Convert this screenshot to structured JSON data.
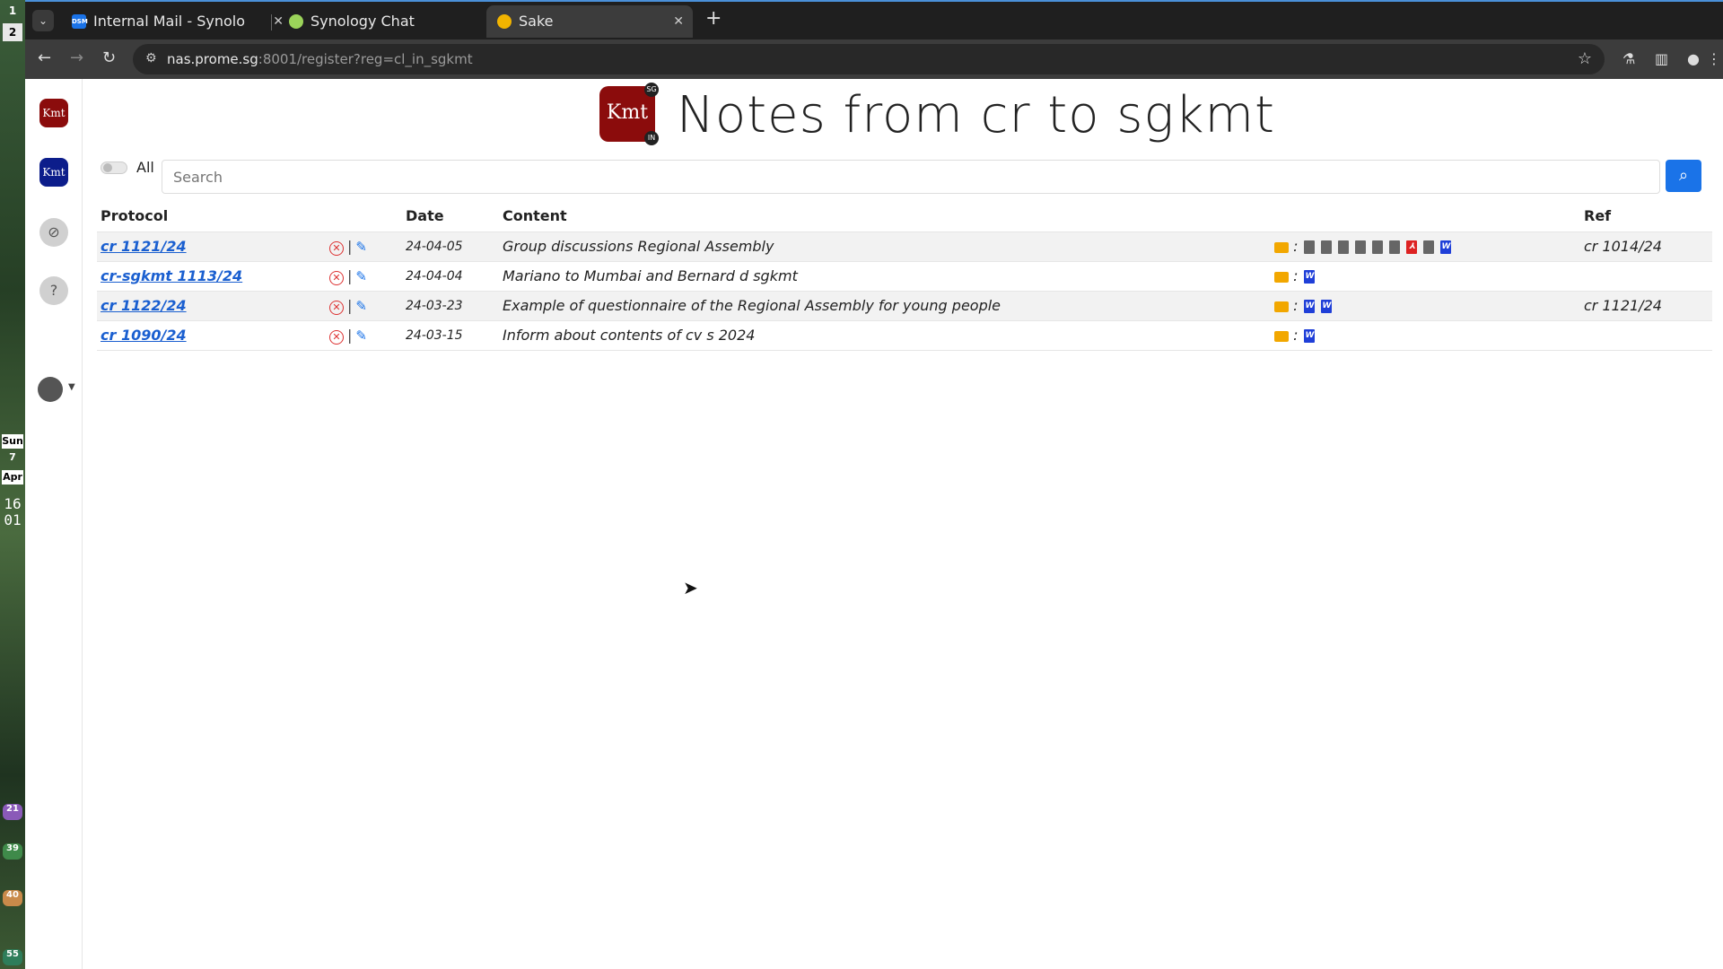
{
  "desktop": {
    "workspaces": [
      "1",
      "2"
    ],
    "date": {
      "day": "Sun",
      "num": "7",
      "month": "Apr"
    },
    "clock": [
      "16",
      "01"
    ],
    "pills": [
      {
        "value": "21",
        "color": "#8a5ab8"
      },
      {
        "value": "39",
        "color": "#3f8a4a"
      },
      {
        "value": "40",
        "color": "#c98a4a"
      },
      {
        "value": "55",
        "color": "#2e7d5a"
      }
    ]
  },
  "browser": {
    "tabs": [
      {
        "title": "Internal Mail - Synolo",
        "fav_color": "#1a73e8",
        "fav_text": "DSM"
      },
      {
        "title": "Synology Chat",
        "fav_color": "#9bd35a",
        "fav_text": ""
      },
      {
        "title": "Sake",
        "fav_color": "#f2b400",
        "fav_text": "",
        "active": true
      }
    ],
    "url_host": "nas.prome.sg",
    "url_rest": ":8001/register?reg=cl_in_sgkmt"
  },
  "sidebar": {
    "items": [
      {
        "label": "Kmt",
        "style": "kmt-red"
      },
      {
        "label": "Kmt",
        "style": "kmt-blue"
      },
      {
        "label": "⊘",
        "style": "round"
      },
      {
        "label": "?",
        "style": "round"
      }
    ]
  },
  "header": {
    "logo_text": "Kmt",
    "logo_badge_top": "SG",
    "logo_badge_bottom": "IN",
    "title": "Notes from cr to sgkmt"
  },
  "filters": {
    "all_label": "All",
    "search_placeholder": "Search"
  },
  "table": {
    "columns": {
      "protocol": "Protocol",
      "date": "Date",
      "content": "Content",
      "ref": "Ref"
    },
    "rows": [
      {
        "protocol": "cr 1121/24",
        "date": "24-04-05",
        "content": "Group discussions Regional Assembly",
        "files": [
          "gray",
          "gray",
          "gray",
          "gray",
          "gray",
          "gray",
          "pdf",
          "gray",
          "word"
        ],
        "ref": "cr 1014/24"
      },
      {
        "protocol": "cr-sgkmt 1113/24",
        "date": "24-04-04",
        "content": "Mariano to Mumbai and Bernard d sgkmt",
        "files": [
          "word"
        ],
        "ref": ""
      },
      {
        "protocol": "cr 1122/24",
        "date": "24-03-23",
        "content": "Example of questionnaire of the Regional Assembly for young people",
        "files": [
          "word",
          "word"
        ],
        "ref": "cr 1121/24"
      },
      {
        "protocol": "cr 1090/24",
        "date": "24-03-15",
        "content": "Inform about contents of cv s 2024",
        "files": [
          "word"
        ],
        "ref": ""
      }
    ]
  }
}
